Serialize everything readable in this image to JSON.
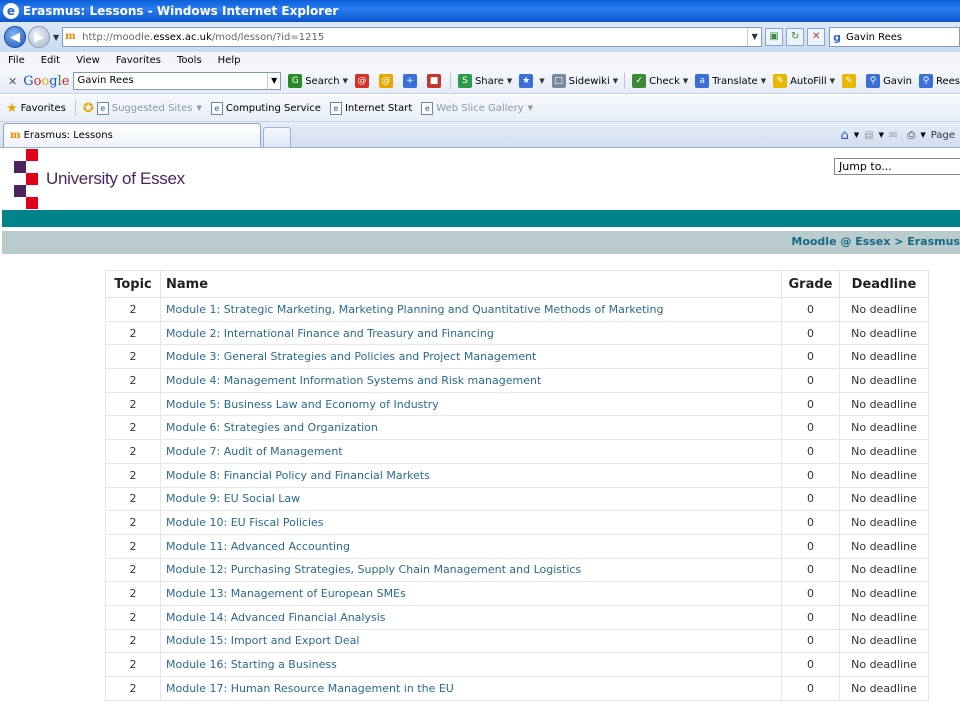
{
  "window": {
    "title": "Erasmus: Lessons - Windows Internet Explorer"
  },
  "address_bar": {
    "url_prefix": "http://moodle.",
    "url_host": "essex.ac.uk",
    "url_path": "/mod/lesson/?id=1215",
    "search_value": "Gavin Rees"
  },
  "menu": [
    "File",
    "Edit",
    "View",
    "Favorites",
    "Tools",
    "Help"
  ],
  "google_toolbar": {
    "search_value": "Gavin Rees",
    "tools": [
      {
        "label": "Search",
        "icon": "google-search-icon",
        "color": "#2a8a2a"
      },
      {
        "label": "",
        "icon": "swirl-icon",
        "color": "#d93025"
      },
      {
        "label": "",
        "icon": "swirl-icon",
        "color": "#e6a800"
      },
      {
        "label": "",
        "icon": "plus-icon",
        "color": "#3a6fd8"
      },
      {
        "label": "",
        "icon": "eraser-icon",
        "color": "#c0392b"
      },
      {
        "label": "Share",
        "icon": "share-icon",
        "color": "#2a9a4a"
      },
      {
        "label": "",
        "icon": "bookmark-icon",
        "color": "#3a6fd8"
      },
      {
        "label": "Sidewiki",
        "icon": "sidewiki-icon",
        "color": "#7a8aa0"
      },
      {
        "label": "Check",
        "icon": "spellcheck-icon",
        "color": "#3a8a3a"
      },
      {
        "label": "Translate",
        "icon": "translate-icon",
        "color": "#3a6fd8"
      },
      {
        "label": "AutoFill",
        "icon": "autofill-icon",
        "color": "#e6b800"
      },
      {
        "label": "",
        "icon": "pencil-icon",
        "color": "#e6b800"
      },
      {
        "label": "Gavin",
        "icon": "magnifier-icon",
        "color": "#3a6fd8"
      },
      {
        "label": "Rees",
        "icon": "magnifier-icon",
        "color": "#3a6fd8"
      }
    ]
  },
  "favorites_bar": {
    "favorites_label": "Favorites",
    "items": [
      {
        "label": "Suggested Sites",
        "greyed": true
      },
      {
        "label": "Computing Service",
        "greyed": false
      },
      {
        "label": "Internet Start",
        "greyed": false
      },
      {
        "label": "Web Slice Gallery",
        "greyed": true
      }
    ]
  },
  "tab": {
    "label": "Erasmus: Lessons"
  },
  "tab_tools": {
    "page_label": "Page"
  },
  "site": {
    "logo_text": "University of Essex",
    "jump_to": "Jump to...",
    "breadcrumb": "Moodle @ Essex > Erasmus",
    "colors": {
      "teal": "#00838a",
      "nav": "#b9cbcc",
      "logo_purple": "#4d2461",
      "logo_red": "#e3001b"
    }
  },
  "table": {
    "headers": [
      "Topic",
      "Name",
      "Grade",
      "Deadline"
    ],
    "rows": [
      {
        "topic": "2",
        "name": "Module 1: Strategic Marketing, Marketing Planning and Quantitative Methods of Marketing",
        "grade": "0",
        "deadline": "No deadline"
      },
      {
        "topic": "2",
        "name": "Module 2: International Finance and Treasury and Financing",
        "grade": "0",
        "deadline": "No deadline"
      },
      {
        "topic": "2",
        "name": "Module 3: General Strategies and Policies and Project Management",
        "grade": "0",
        "deadline": "No deadline"
      },
      {
        "topic": "2",
        "name": "Module 4: Management Information Systems and Risk management",
        "grade": "0",
        "deadline": "No deadline"
      },
      {
        "topic": "2",
        "name": "Module 5: Business Law and Economy of Industry",
        "grade": "0",
        "deadline": "No deadline"
      },
      {
        "topic": "2",
        "name": "Module 6: Strategies and Organization",
        "grade": "0",
        "deadline": "No deadline"
      },
      {
        "topic": "2",
        "name": "Module 7: Audit of Management",
        "grade": "0",
        "deadline": "No deadline"
      },
      {
        "topic": "2",
        "name": "Module 8: Financial Policy and Financial Markets",
        "grade": "0",
        "deadline": "No deadline"
      },
      {
        "topic": "2",
        "name": "Module 9: EU Social Law",
        "grade": "0",
        "deadline": "No deadline"
      },
      {
        "topic": "2",
        "name": "Module 10: EU Fiscal Policies",
        "grade": "0",
        "deadline": "No deadline"
      },
      {
        "topic": "2",
        "name": "Module 11: Advanced Accounting",
        "grade": "0",
        "deadline": "No deadline"
      },
      {
        "topic": "2",
        "name": "Module 12: Purchasing Strategies, Supply Chain Management and Logistics",
        "grade": "0",
        "deadline": "No deadline"
      },
      {
        "topic": "2",
        "name": "Module 13: Management of European SMEs",
        "grade": "0",
        "deadline": "No deadline"
      },
      {
        "topic": "2",
        "name": "Module 14: Advanced Financial Analysis",
        "grade": "0",
        "deadline": "No deadline"
      },
      {
        "topic": "2",
        "name": "Module 15: Import and Export Deal",
        "grade": "0",
        "deadline": "No deadline"
      },
      {
        "topic": "2",
        "name": "Module 16: Starting a Business",
        "grade": "0",
        "deadline": "No deadline"
      },
      {
        "topic": "2",
        "name": "Module 17: Human Resource Management in the EU",
        "grade": "0",
        "deadline": "No deadline"
      }
    ]
  }
}
